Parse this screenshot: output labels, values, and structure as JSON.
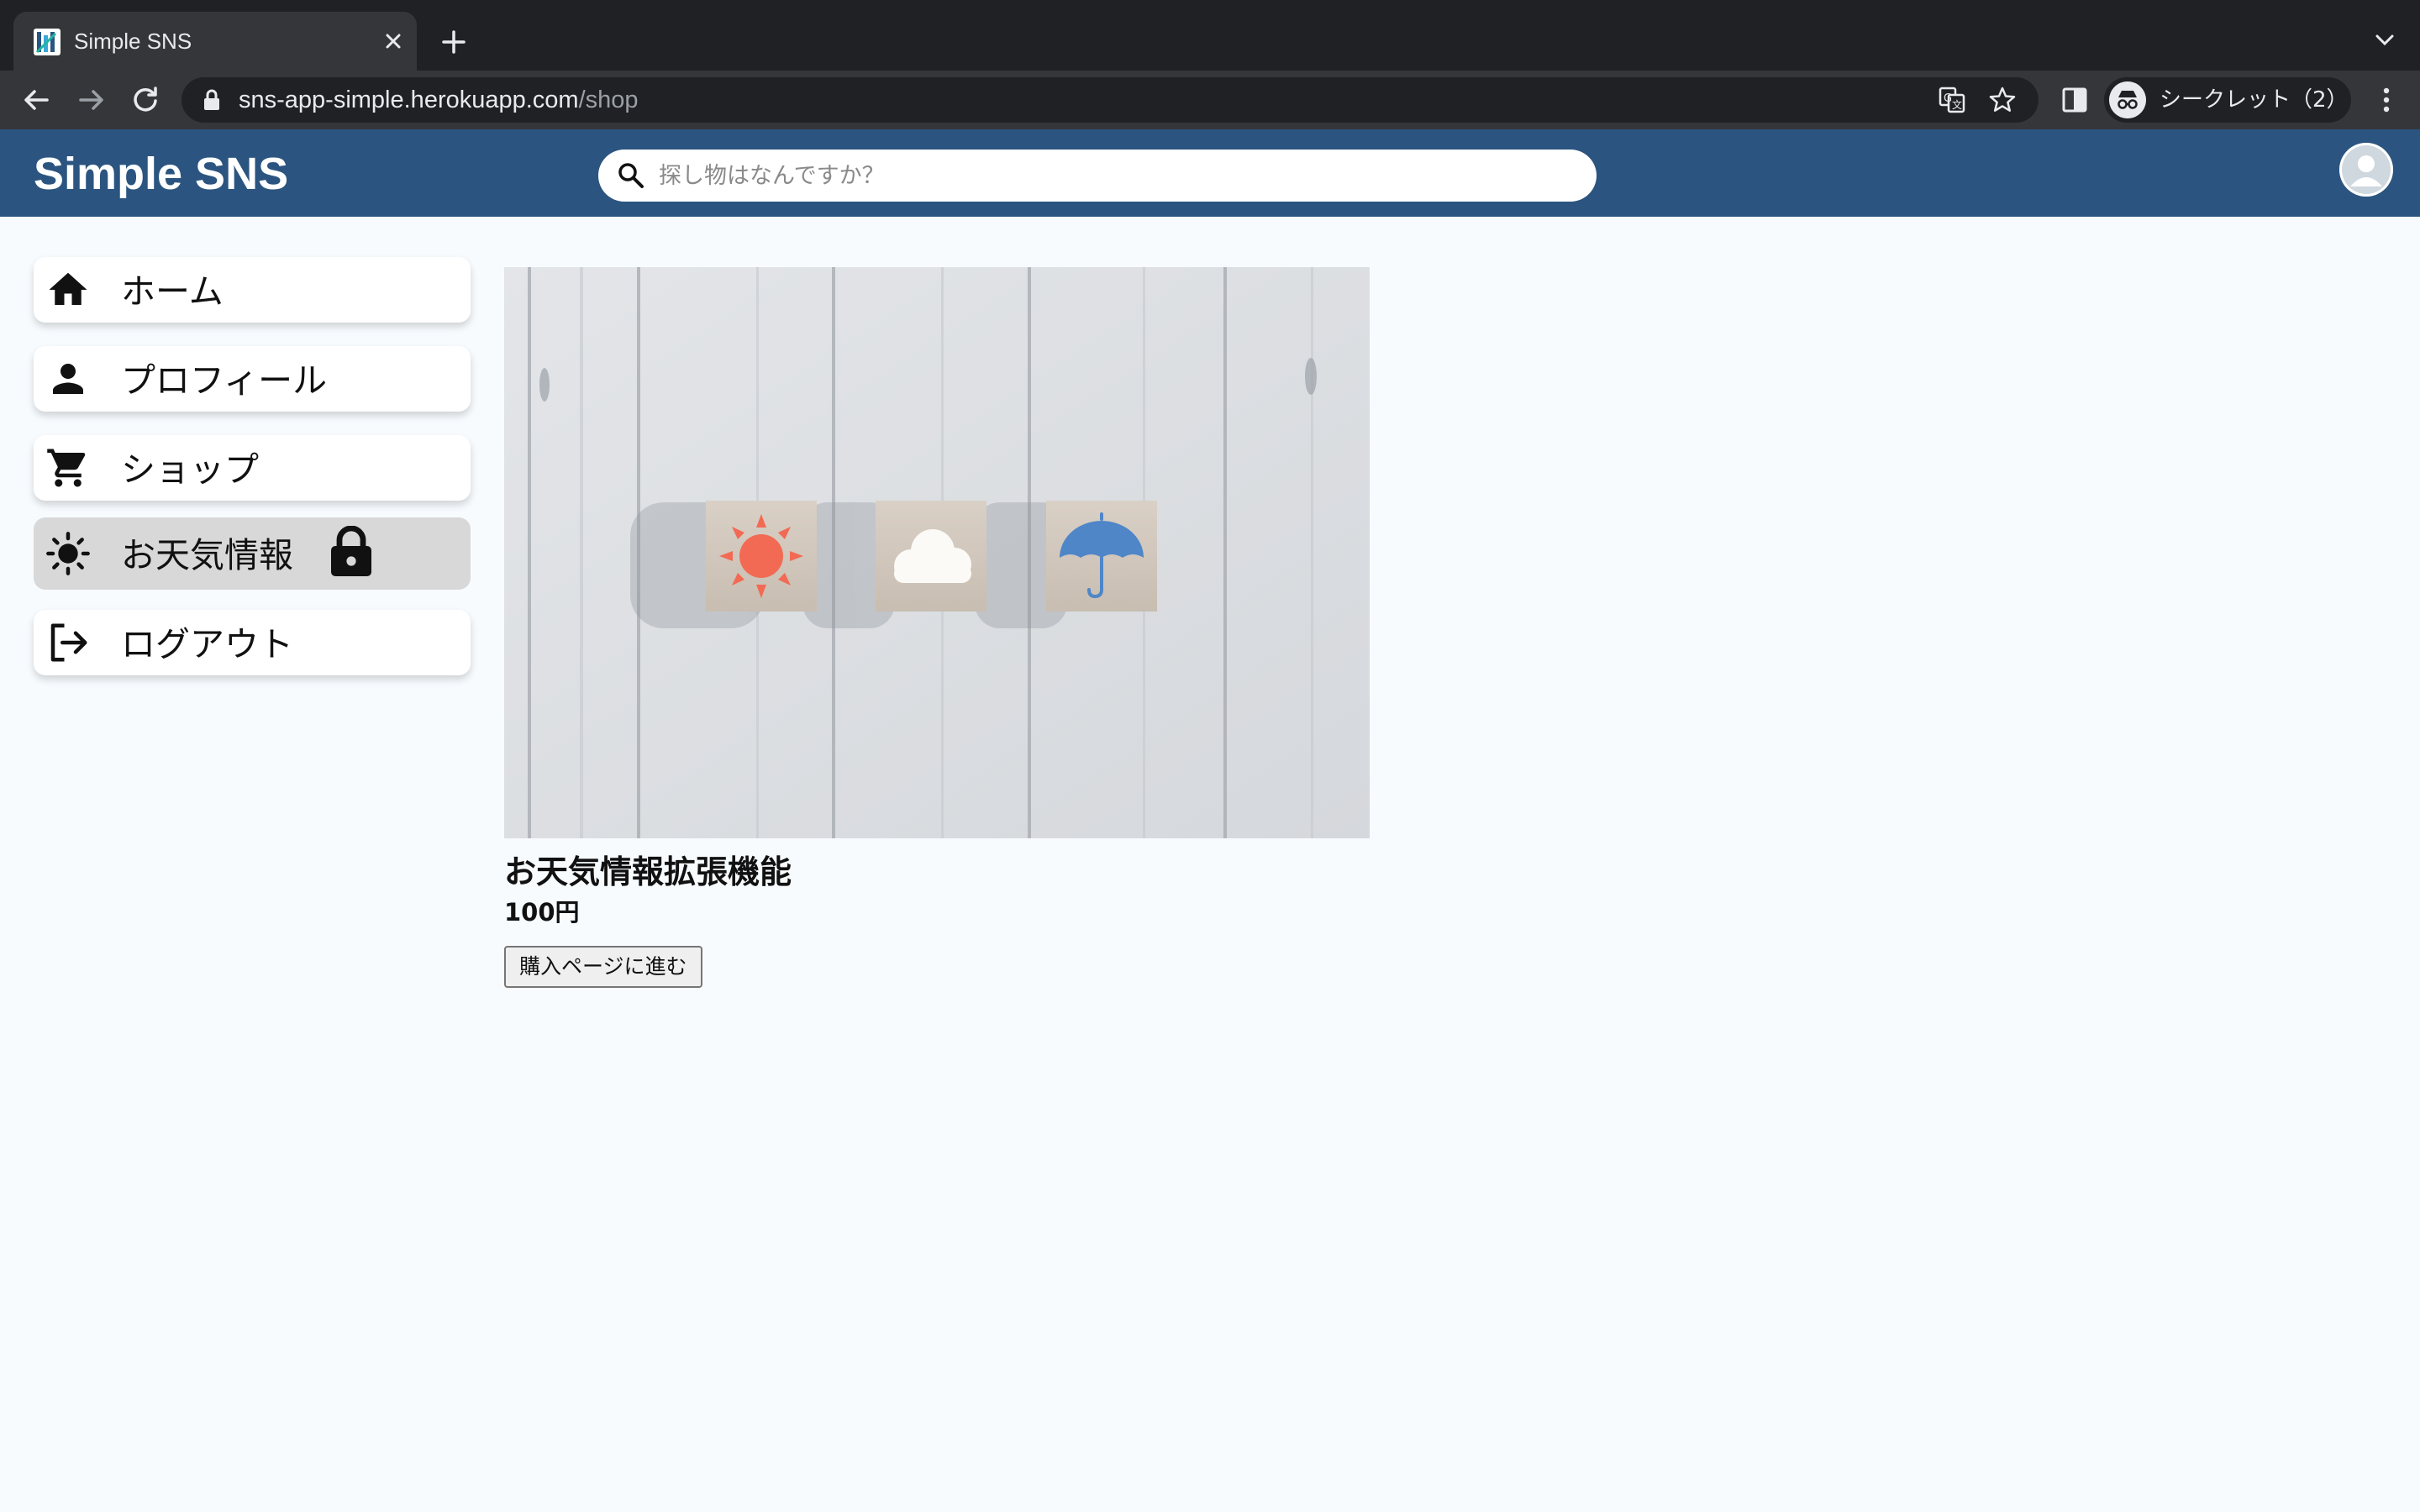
{
  "browser": {
    "tab_title": "Simple SNS",
    "url_host": "sns-app-simple.herokuapp.com",
    "url_path": "/shop",
    "incognito_label": "シークレット（2）",
    "icons": [
      "back-arrow-icon",
      "forward-arrow-icon",
      "reload-icon",
      "lock-icon",
      "translate-icon",
      "star-icon",
      "side-panel-icon",
      "incognito-icon",
      "kebab-menu-icon",
      "close-icon",
      "plus-icon",
      "chevron-down-icon"
    ]
  },
  "header": {
    "brand": "Simple SNS",
    "search_placeholder": "探し物はなんですか？",
    "background_color": "#2b5580"
  },
  "sidebar": {
    "items": [
      {
        "label": "ホーム",
        "icon": "home-icon",
        "active": false
      },
      {
        "label": "プロフィール",
        "icon": "person-icon",
        "active": false
      },
      {
        "label": "ショップ",
        "icon": "cart-icon",
        "active": false
      },
      {
        "label": "お天気情報",
        "icon": "sun-icon",
        "active": true,
        "locked": true
      },
      {
        "label": "ログアウト",
        "icon": "logout-icon",
        "active": false
      }
    ]
  },
  "product": {
    "name": "お天気情報拡張機能",
    "price": "100円",
    "buy_label": "購入ページに進む",
    "image_alt": "sun, cloud and umbrella blocks on wooden boards"
  }
}
